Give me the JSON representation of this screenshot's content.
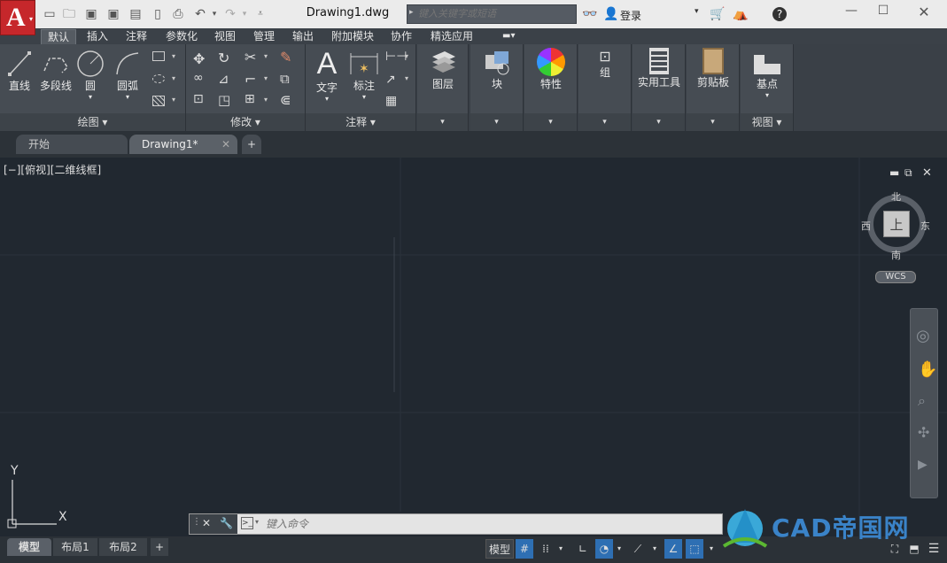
{
  "app": {
    "logo_letter": "A",
    "doc_title": "Drawing1.dwg"
  },
  "search": {
    "placeholder": "键入关键字或短语"
  },
  "account": {
    "login_label": "登录"
  },
  "ribbon_tabs": [
    "默认",
    "插入",
    "注释",
    "参数化",
    "视图",
    "管理",
    "输出",
    "附加模块",
    "协作",
    "精选应用"
  ],
  "active_tab": "默认",
  "panels": {
    "draw": {
      "title": "绘图 ▾",
      "tools": [
        "直线",
        "多段线",
        "圆",
        "圆弧"
      ]
    },
    "modify": {
      "title": "修改 ▾"
    },
    "annotation": {
      "title": "注释 ▾",
      "tools": [
        "文字",
        "标注"
      ]
    },
    "layers": {
      "label": "图层"
    },
    "block": {
      "label": "块"
    },
    "properties": {
      "label": "特性"
    },
    "groups": {
      "label": "组"
    },
    "utilities": {
      "label": "实用工具"
    },
    "clipboard": {
      "label": "剪贴板"
    },
    "view": {
      "tool": "基点",
      "title": "视图 ▾"
    }
  },
  "file_tabs": {
    "start": "开始",
    "drawing": "Drawing1*"
  },
  "viewport": {
    "label": "[−][俯视][二维线框]"
  },
  "viewcube": {
    "north": "北",
    "south": "南",
    "east": "东",
    "west": "西",
    "top": "上",
    "wcs": "WCS"
  },
  "ucs": {
    "x": "X",
    "y": "Y"
  },
  "command": {
    "placeholder": "键入命令"
  },
  "layout_tabs": [
    "模型",
    "布局1",
    "布局2"
  ],
  "status": {
    "model_label": "模型"
  },
  "watermark": {
    "text": "CAD帝国网"
  },
  "colors": {
    "accent": "#c6272b",
    "ribbon": "#3a4047",
    "viewport": "#212830"
  }
}
